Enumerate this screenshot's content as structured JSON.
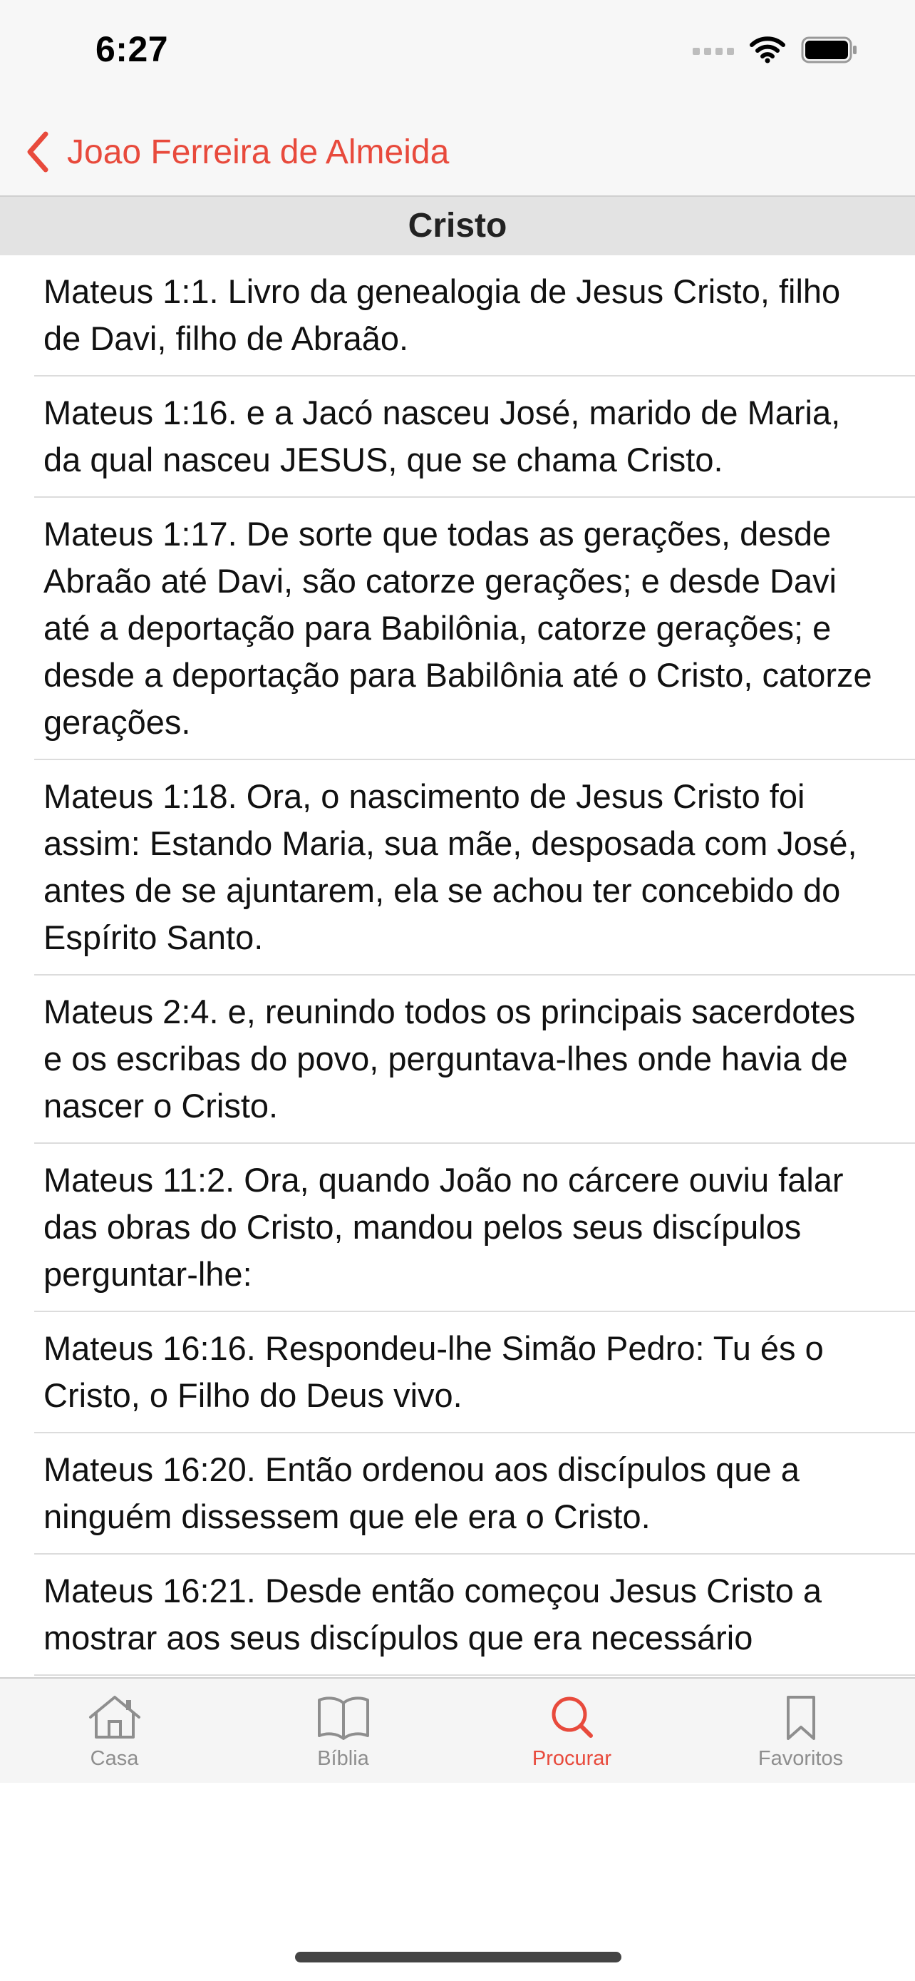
{
  "status_bar": {
    "time": "6:27"
  },
  "nav": {
    "back_label": "Joao Ferreira de Almeida",
    "accent_color": "#e84a3c"
  },
  "section": {
    "title": "Cristo"
  },
  "verses": [
    "Mateus 1:1. Livro da genealogia de Jesus Cristo, filho de Davi, filho de Abraão.",
    "Mateus 1:16. e a Jacó nasceu José, marido de Maria, da qual nasceu JESUS, que se chama Cristo.",
    "Mateus 1:17. De sorte que todas as gerações, desde Abraão até Davi, são catorze gerações; e desde Davi até a deportação para Babilônia, catorze gerações; e desde a deportação para Babilônia até o Cristo, catorze gerações.",
    "Mateus 1:18. Ora, o nascimento de Jesus Cristo foi assim: Estando Maria, sua mãe, desposada com José, antes de se ajuntarem, ela se achou ter concebido do Espírito Santo.",
    "Mateus 2:4. e, reunindo todos os principais sacerdotes e os escribas do povo, perguntava-lhes onde havia de nascer o Cristo.",
    "Mateus 11:2. Ora, quando João no cárcere ouviu falar das obras do Cristo, mandou pelos seus discípulos perguntar-lhe:",
    "Mateus 16:16. Respondeu-lhe Simão Pedro: Tu és o Cristo, o Filho do Deus vivo.",
    "Mateus 16:20. Então ordenou aos discípulos que a ninguém dissessem que ele era o Cristo.",
    "Mateus 16:21. Desde então começou Jesus Cristo a mostrar aos seus discípulos que era necessário"
  ],
  "tabs": [
    {
      "label": "Casa",
      "icon": "house-icon"
    },
    {
      "label": "Bíblia",
      "icon": "book-icon"
    },
    {
      "label": "Procurar",
      "icon": "search-icon"
    },
    {
      "label": "Favoritos",
      "icon": "bookmark-icon"
    }
  ],
  "active_tab": "Procurar"
}
